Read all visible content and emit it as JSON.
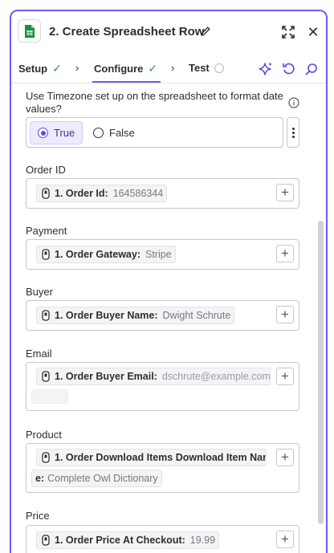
{
  "header": {
    "step_title": "2. Create Spreadsheet Row",
    "app_icon": "google-sheets-icon",
    "icons": [
      "pencil-icon",
      "expand-icon",
      "close-icon"
    ],
    "close_glyph": "✕"
  },
  "tabs": [
    {
      "label": "Setup",
      "status": "complete"
    },
    {
      "label": "Configure",
      "status": "complete",
      "active": true
    },
    {
      "label": "Test",
      "status": "pending"
    }
  ],
  "toolbar_icons": [
    "ai-sparkle-icon",
    "refresh-icon",
    "search-icon"
  ],
  "timezone_question": {
    "label": "Use Timezone set up on the spreadsheet to format date values?",
    "options": [
      "True",
      "False"
    ],
    "selected": "True"
  },
  "fields": {
    "order_id": {
      "label": "Order ID",
      "key": "1. Order Id:",
      "value": "164586344"
    },
    "payment": {
      "label": "Payment",
      "key": "1. Order Gateway:",
      "value": "Stripe"
    },
    "buyer": {
      "label": "Buyer",
      "key": "1. Order Buyer Name:",
      "value": "Dwight Schrute"
    },
    "email": {
      "label": "Email",
      "key": "1. Order Buyer Email:",
      "value": "dschrute@example.com"
    },
    "product": {
      "label": "Product",
      "key": "1. Order Download Items Download Item Nam",
      "key_cont": "e:",
      "value": "Complete Owl Dictionary"
    },
    "price": {
      "label": "Price",
      "key": "1. Order Price At Checkout:",
      "value": "19.99"
    }
  },
  "colors": {
    "accent": "#6b5cf5",
    "check": "#1e9f54",
    "sheets_green": "#1e8e3e"
  }
}
